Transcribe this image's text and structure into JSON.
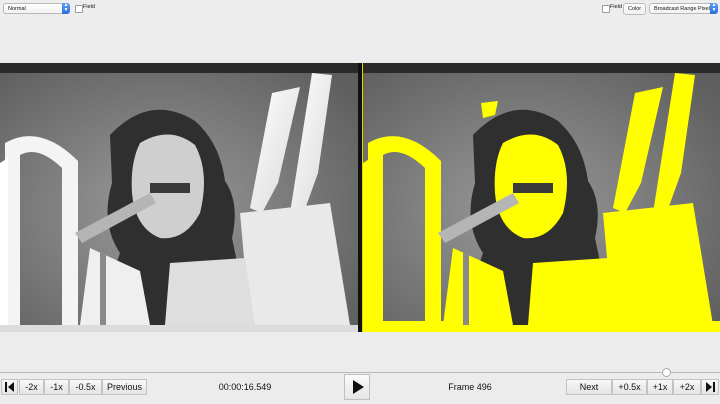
{
  "top_bar": {
    "mode_select": "Normal",
    "field_left_label": "Field",
    "field_right_label": "Field",
    "color_button": "Color",
    "range_select": "Broadcast Range Pixels"
  },
  "controls": {
    "step_back_icon": "step-back-icon",
    "minus2x": "-2x",
    "minus1x": "-1x",
    "minus05x": "-0.5x",
    "previous": "Previous",
    "timecode": "00:00:16.549",
    "play_icon": "play-icon",
    "frame_label": "Frame 496",
    "next": "Next",
    "plus05x": "+0.5x",
    "plus1x": "+1x",
    "plus2x": "+2x",
    "step_forward_icon": "step-forward-icon"
  },
  "colors": {
    "highlight": "#ffff00",
    "background": "#ececec"
  },
  "seek": {
    "position_fraction": 0.925
  }
}
